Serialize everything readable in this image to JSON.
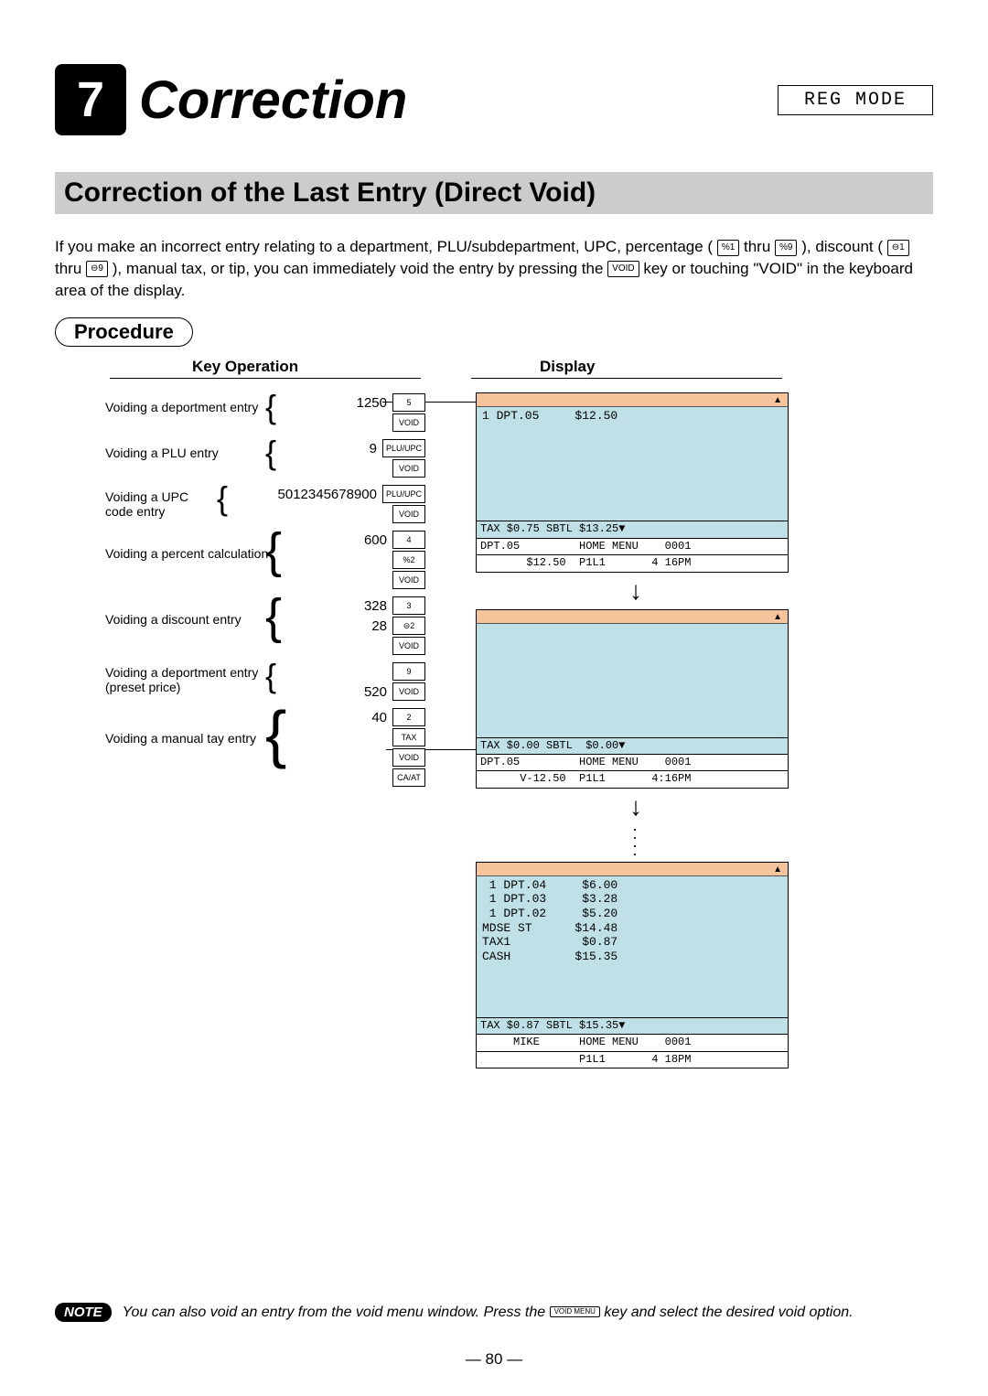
{
  "chapter": {
    "number": "7",
    "title": "Correction",
    "mode": "REG MODE"
  },
  "section_title": "Correction of the Last Entry (Direct Void)",
  "intro": {
    "part1": "If you make an incorrect entry relating to a department, PLU/subdepartment, UPC, percentage ( ",
    "key1": "%1",
    "thru1": " thru ",
    "key2": "%9",
    "part2": " ), discount ( ",
    "key3": "⊖1",
    "thru2": " thru ",
    "key4": "⊖9",
    "part3": " ), manual tax, or tip, you can immediately void the entry by pressing the ",
    "key5": "VOID",
    "part4": " key or touching \"VOID\" in the keyboard area of the display."
  },
  "procedure_label": "Procedure",
  "columns": {
    "key_op": "Key Operation",
    "display": "Display"
  },
  "ops": [
    {
      "label": "Voiding a deportment entry",
      "lines": [
        {
          "num": "1250",
          "key": "5"
        },
        {
          "num": "",
          "key": "VOID"
        }
      ]
    },
    {
      "label": "Voiding a PLU entry",
      "lines": [
        {
          "num": "9",
          "key": "PLU/UPC"
        },
        {
          "num": "",
          "key": "VOID"
        }
      ]
    },
    {
      "label": "Voiding a UPC code entry",
      "num_prefix": "5012345678900",
      "lines": [
        {
          "num": "",
          "key": "PLU/UPC"
        },
        {
          "num": "",
          "key": "VOID"
        }
      ]
    },
    {
      "label": "Voiding a percent calculation",
      "lines": [
        {
          "num": "600",
          "key": "4"
        },
        {
          "num": "",
          "key": "%2"
        },
        {
          "num": "",
          "key": "VOID"
        }
      ]
    },
    {
      "label": "Voiding a discount entry",
      "lines": [
        {
          "num": "328",
          "key": "3"
        },
        {
          "num": "28",
          "key": "⊖2"
        },
        {
          "num": "",
          "key": "VOID"
        }
      ]
    },
    {
      "label": "Voiding a deportment entry (preset price)",
      "lines": [
        {
          "num": "",
          "key": "9"
        },
        {
          "num": "520",
          "key": "VOID"
        }
      ]
    },
    {
      "label": "Voiding a manual tay entry",
      "lines": [
        {
          "num": "40",
          "key": "2"
        },
        {
          "num": "",
          "key": "TAX"
        },
        {
          "num": "",
          "key": "VOID"
        },
        {
          "num": "",
          "key": "CA/AT"
        }
      ]
    }
  ],
  "screens": {
    "s1": {
      "line": "1 DPT.05     $12.50",
      "status1": "TAX $0.75 SBTL $13.25▼",
      "status2": "DPT.05         HOME MENU    0001",
      "status3": "       $12.50  P1L1       4 16PM"
    },
    "s2": {
      "status1": "TAX $0.00 SBTL  $0.00▼",
      "status2": "DPT.05         HOME MENU    0001",
      "status3": "      V-12.50  P1L1       4:16PM"
    },
    "s3": {
      "rows": [
        " 1 DPT.04     $6.00",
        " 1 DPT.03     $3.28",
        " 1 DPT.02     $5.20",
        "MDSE ST      $14.48",
        "TAX1          $0.87",
        "CASH         $15.35"
      ],
      "status1": "TAX $0.87 SBTL $15.35▼",
      "status2": "     MIKE      HOME MENU    0001",
      "status3": "               P1L1       4 18PM"
    }
  },
  "note": {
    "badge": "NOTE",
    "text1": "You can also void an entry from the void menu window. Press the ",
    "key": "VOID MENU",
    "text2": " key and select the desired void option."
  },
  "page_number": "— 80 —"
}
